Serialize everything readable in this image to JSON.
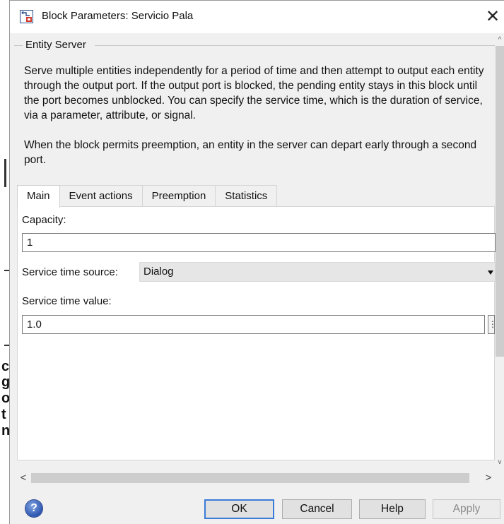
{
  "window": {
    "title": "Block Parameters: Servicio Pala",
    "close_glyph": "✕"
  },
  "description": {
    "group_title": "Entity Server",
    "text": "Serve multiple entities independently for a period of time and then attempt to output each entity through the output port. If the output port is blocked, the pending entity stays in this block until the port becomes unblocked. You can specify the service time, which is the duration of service, via a parameter, attribute, or signal.\n\nWhen the block permits preemption, an entity in the server can depart early through a second port."
  },
  "tabs": [
    {
      "label": "Main",
      "active": true
    },
    {
      "label": "Event actions",
      "active": false
    },
    {
      "label": "Preemption",
      "active": false
    },
    {
      "label": "Statistics",
      "active": false
    }
  ],
  "main": {
    "capacity_label": "Capacity:",
    "capacity_value": "1",
    "service_source_label": "Service time source:",
    "service_source_value": "Dialog",
    "service_time_label": "Service time value:",
    "service_time_value": "1.0",
    "service_time_button": "⋮"
  },
  "scroll": {
    "up": "^",
    "down": "v",
    "left": "<",
    "right": ">"
  },
  "buttons": {
    "help_icon_glyph": "?",
    "ok": "OK",
    "cancel": "Cancel",
    "help": "Help",
    "apply": "Apply"
  },
  "background": {
    "glyphs": [
      "c",
      "g",
      "o",
      "t",
      "n"
    ]
  }
}
